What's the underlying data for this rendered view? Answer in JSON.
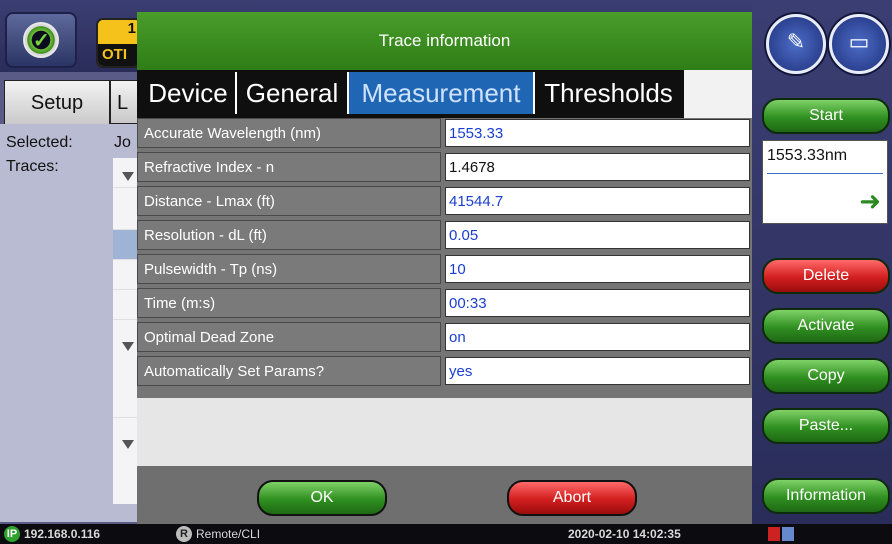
{
  "background": {
    "otdr_badge": {
      "number": "1",
      "label": "OTI"
    },
    "tabs": [
      {
        "label": "Setup"
      },
      {
        "label": "L"
      }
    ],
    "selected_label": "Selected:",
    "selected_value": "Jo",
    "traces_label": "Traces:"
  },
  "right_panel": {
    "buttons": {
      "start": "Start",
      "delete": "Delete",
      "activate": "Activate",
      "copy": "Copy",
      "paste": "Paste...",
      "information": "Information"
    },
    "wavelength": "1553.33nm"
  },
  "dialog": {
    "title": "Trace information",
    "tabs": [
      {
        "label": "Device"
      },
      {
        "label": "General"
      },
      {
        "label": "Measurement"
      },
      {
        "label": "Thresholds"
      }
    ],
    "active_tab": "Measurement",
    "rows": [
      {
        "label": "Accurate Wavelength (nm)",
        "value": "1553.33"
      },
      {
        "label": "Refractive Index - n",
        "value": "1.4678"
      },
      {
        "label": "Distance - Lmax (ft)",
        "value": "41544.7"
      },
      {
        "label": "Resolution - dL (ft)",
        "value": "0.05"
      },
      {
        "label": "Pulsewidth - Tp (ns)",
        "value": "10"
      },
      {
        "label": "Time (m:s)",
        "value": "00:33"
      },
      {
        "label": "Optimal Dead Zone",
        "value": "on"
      },
      {
        "label": "Automatically Set Params?",
        "value": "yes"
      }
    ],
    "ok_label": "OK",
    "abort_label": "Abort"
  },
  "statusbar": {
    "ip_icon": "IP",
    "ip": "192.168.0.116",
    "remote_icon": "R",
    "remote": "Remote/CLI",
    "datetime": "2020-02-10  14:02:35"
  }
}
